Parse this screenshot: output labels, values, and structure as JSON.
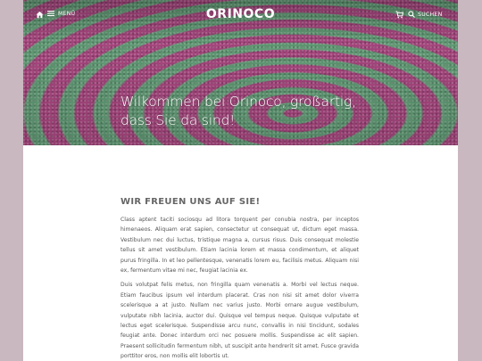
{
  "header": {
    "menu_label": "MENÜ",
    "logo": "ORINOCO",
    "search_label": "SUCHEN"
  },
  "hero": {
    "title": "Wilkommen bei Orinoco, großartig, dass Sie da sind!"
  },
  "main": {
    "section_title": "WIR FREUEN UNS AUF SIE!",
    "paragraphs": [
      "Class aptent taciti sociosqu ad litora torquent per conubia nostra, per inceptos himenaeos. Aliquam erat sapien, consectetur ut consequat ut, dictum eget massa. Vestibulum nec dui luctus, tristique magna a, cursus risus. Duis consequat molestie tellus sit amet vestibulum. Etiam lacinia lorem et massa condimentum, et aliquet purus fringilla. In et leo pellentesque, venenatis lorem eu, facilisis metus. Aliquam nisi ex, fermentum vitae mi nec, feugiat lacinia ex.",
      "Duis volutpat felis metus, non fringilla quam venenatis a. Morbi vel lectus neque. Etiam faucibus ipsum vel interdum placerat. Cras non nisi sit amet dolor viverra scelerisque a at justo. Nullam nec varius justo. Morbi ornare augue vestibulum, vulputate nibh lacinia, auctor dui. Quisque vel tempus neque. Quisque vulputate et lectus eget scelerisque. Suspendisse arcu nunc, convallis in nisi tincidunt, sodales feugiat ante. Donec interdum orci nec posuere mollis. Suspendisse ac elit sapien. Praesent sollicitudin fermentum nibh, ut suscipit ante hendrerit sit amet. Fusce gravida porttitor eros, non mollis elit lobortis ut."
    ]
  },
  "colors": {
    "page_background": "#c9b8c0",
    "hero_magenta": "#b04b86",
    "hero_green": "#6aa57e",
    "text": "#555555"
  },
  "icons": [
    "home-icon",
    "menu-icon",
    "cart-icon",
    "search-icon"
  ]
}
